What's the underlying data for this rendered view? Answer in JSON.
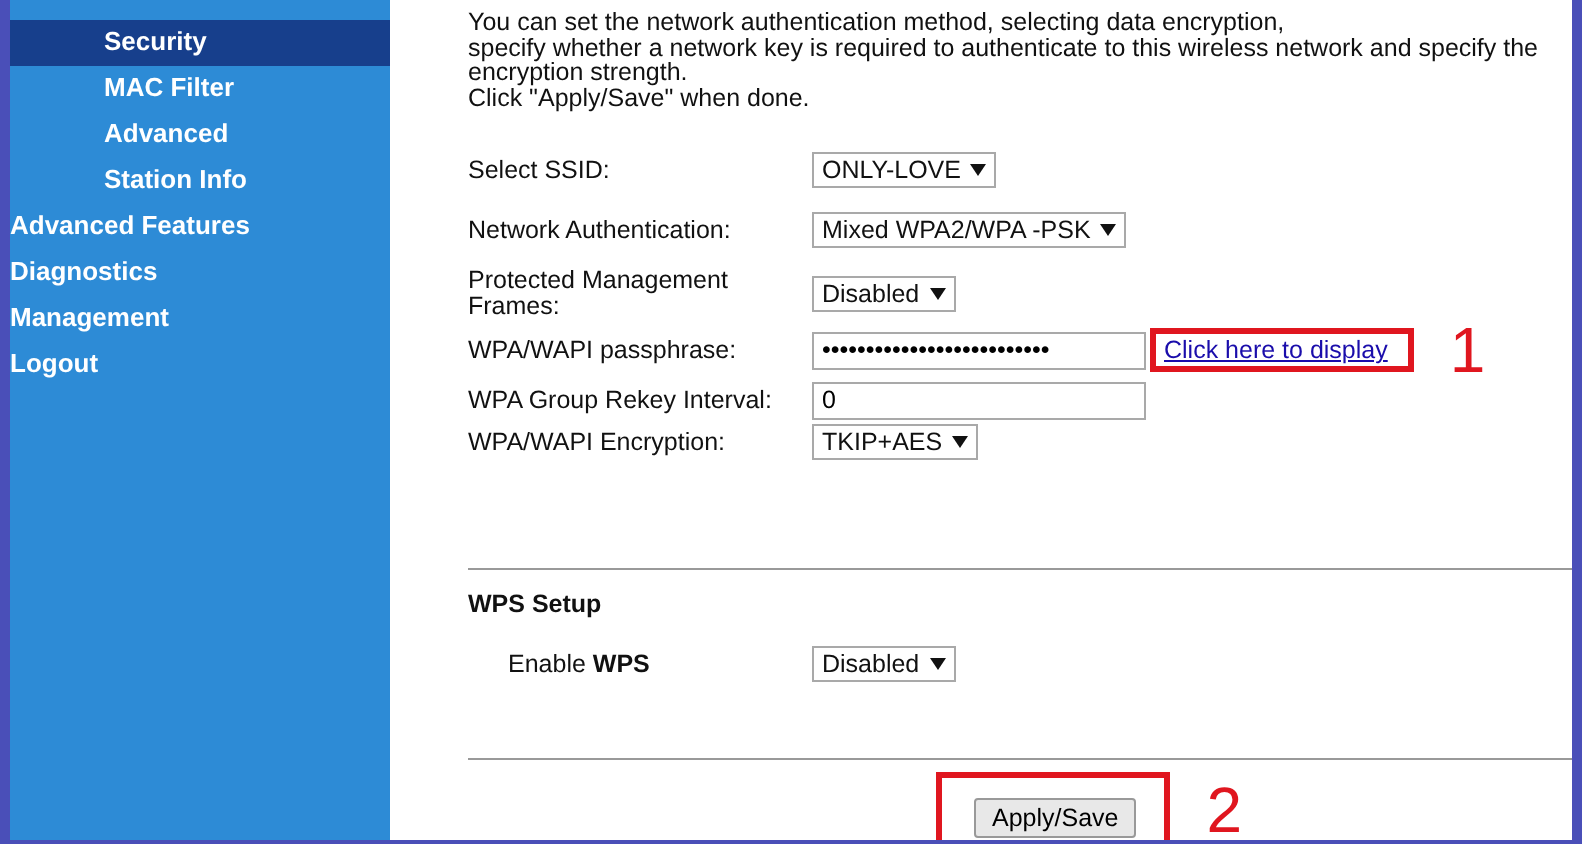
{
  "sidebar": {
    "sub_items": [
      {
        "label": "Security",
        "selected": true
      },
      {
        "label": "MAC Filter",
        "selected": false
      },
      {
        "label": "Advanced",
        "selected": false
      },
      {
        "label": "Station Info",
        "selected": false
      }
    ],
    "items": [
      {
        "label": "Advanced Features",
        "selected": false
      },
      {
        "label": "Diagnostics",
        "selected": false
      },
      {
        "label": "Management",
        "selected": false
      },
      {
        "label": "Logout",
        "selected": false
      }
    ]
  },
  "intro": [
    "You can set the network authentication method, selecting data encryption,",
    "specify whether a network key is required to authenticate to this wireless network and specify the encryption strength.",
    "Click \"Apply/Save\" when done."
  ],
  "fields": [
    {
      "kind": "select",
      "label": "Select SSID:",
      "value": "ONLY-LOVE"
    },
    {
      "kind": "select",
      "label": "Network Authentication:",
      "value": "Mixed WPA2/WPA -PSK"
    },
    {
      "kind": "select",
      "label": "Protected Management Frames:",
      "value": "Disabled"
    },
    {
      "kind": "password",
      "label": "WPA/WAPI passphrase:",
      "value": "••••••••••••••••••••••••••",
      "link": "Click here to display",
      "annotation": "1"
    },
    {
      "kind": "input",
      "label": "WPA Group Rekey Interval:",
      "value": "0"
    },
    {
      "kind": "select",
      "label": "WPA/WAPI Encryption:",
      "value": "TKIP+AES"
    }
  ],
  "wps": {
    "heading": "WPS Setup",
    "label": "Enable **WPS**",
    "value": "Disabled"
  },
  "apply": {
    "label": "Apply/Save",
    "annotation": "2"
  }
}
